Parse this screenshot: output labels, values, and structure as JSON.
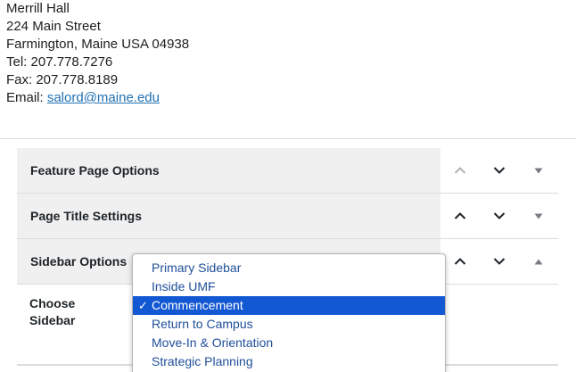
{
  "address": {
    "line1": "Merrill Hall",
    "line2": "224 Main Street",
    "line3": "Farmington, Maine USA 04938",
    "tel": "Tel: 207.778.7276",
    "fax": "Fax: 207.778.8189",
    "email_label": "Email: ",
    "email": "salord@maine.edu"
  },
  "panels": [
    {
      "title": "Feature Page Options"
    },
    {
      "title": "Page Title Settings"
    },
    {
      "title": "Sidebar Options"
    }
  ],
  "sidebar": {
    "field_label": "Choose Sidebar",
    "selected": "Commencement",
    "options": [
      "Primary Sidebar",
      "Inside UMF",
      "Commencement",
      "Return to Campus",
      "Move-In & Orientation",
      "Strategic Planning"
    ]
  },
  "icons": {
    "move_up": "chevron-up-icon",
    "move_down": "chevron-down-icon",
    "collapse": "triangle-down-icon",
    "expand": "triangle-up-icon",
    "selected_mark": "checkmark-icon"
  },
  "colors": {
    "link": "#2271b1",
    "selected_option": "#1358d3",
    "option_text": "#1f4f9a",
    "panel_header_bg": "#f0f0f1"
  }
}
